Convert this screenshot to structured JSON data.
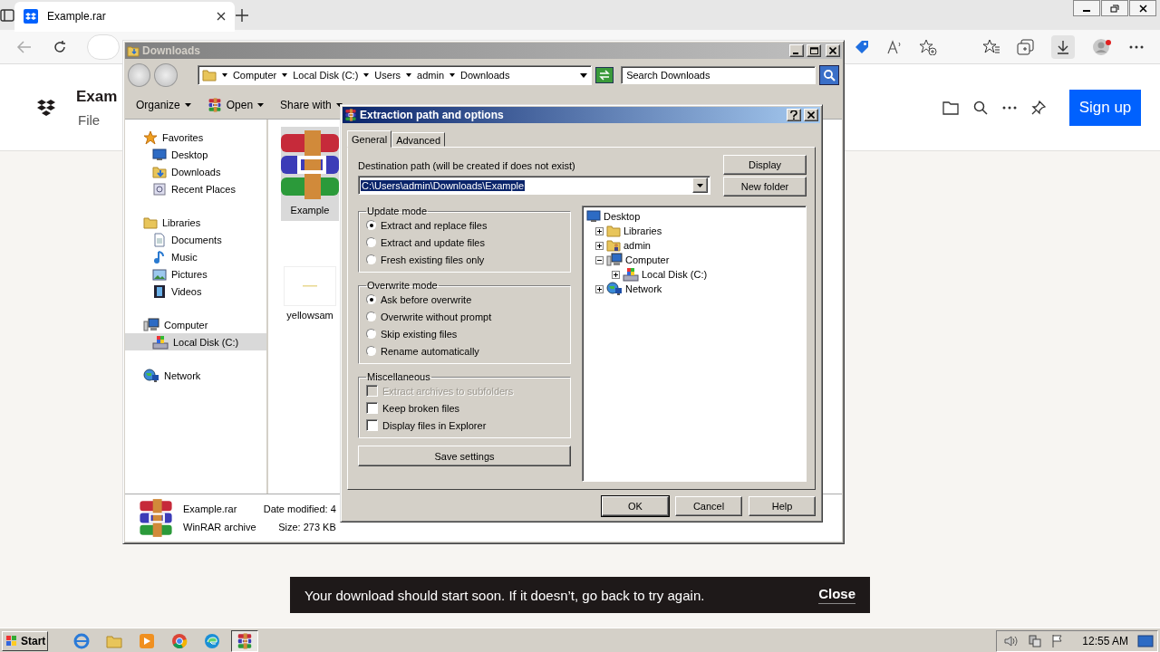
{
  "browser": {
    "tab": {
      "title": "Example.rar"
    },
    "page": {
      "title": "Exam",
      "subtitle": "File",
      "signup": "Sign up"
    },
    "toast": {
      "message": "Your download should start soon. If it doesn’t, go back to try again.",
      "close": "Close"
    }
  },
  "explorer": {
    "title": "Downloads",
    "breadcrumb": [
      "Computer",
      "Local Disk (C:)",
      "Users",
      "admin",
      "Downloads"
    ],
    "search": {
      "placeholder": "Search Downloads"
    },
    "toolbar": [
      "Organize",
      "Open",
      "Share with"
    ],
    "nav": [
      {
        "label": "Favorites",
        "selected": false,
        "children": [
          {
            "label": "Desktop",
            "selected": false
          },
          {
            "label": "Downloads",
            "selected": false
          },
          {
            "label": "Recent Places",
            "selected": false
          }
        ]
      },
      {
        "label": "Libraries",
        "selected": false,
        "children": [
          {
            "label": "Documents",
            "selected": false
          },
          {
            "label": "Music",
            "selected": false
          },
          {
            "label": "Pictures",
            "selected": false
          },
          {
            "label": "Videos",
            "selected": false
          }
        ]
      },
      {
        "label": "Computer",
        "selected": false,
        "children": [
          {
            "label": "Local Disk (C:)",
            "selected": true
          }
        ]
      },
      {
        "label": "Network",
        "selected": false
      }
    ],
    "files": [
      {
        "name": "Example",
        "selected": true
      },
      {
        "name": "yellowsam",
        "selected": false
      }
    ],
    "details": {
      "name": "Example.rar",
      "type": "WinRAR archive",
      "modified": "Date modified: 4",
      "size": "Size: 273 KB"
    }
  },
  "dialog": {
    "title": "Extraction path and options",
    "tabs": [
      {
        "label": "General",
        "selected": true
      },
      {
        "label": "Advanced",
        "selected": false
      }
    ],
    "destination": {
      "label": "Destination path (will be created if does not exist)",
      "value": "C:\\Users\\admin\\Downloads\\Example"
    },
    "side_buttons": [
      "Display",
      "New folder"
    ],
    "update_mode": {
      "title": "Update mode",
      "options": [
        {
          "label": "Extract and replace files",
          "selected": true
        },
        {
          "label": "Extract and update files",
          "selected": false
        },
        {
          "label": "Fresh existing files only",
          "selected": false
        }
      ]
    },
    "overwrite_mode": {
      "title": "Overwrite mode",
      "options": [
        {
          "label": "Ask before overwrite",
          "selected": true
        },
        {
          "label": "Overwrite without prompt",
          "selected": false
        },
        {
          "label": "Skip existing files",
          "selected": false
        },
        {
          "label": "Rename automatically",
          "selected": false
        }
      ]
    },
    "misc": {
      "title": "Miscellaneous",
      "options": [
        {
          "label": "Extract archives to subfolders",
          "checked": false,
          "disabled": true
        },
        {
          "label": "Keep broken files",
          "checked": false,
          "disabled": false
        },
        {
          "label": "Display files in Explorer",
          "checked": false,
          "disabled": false
        }
      ]
    },
    "save": "Save settings",
    "tree": [
      {
        "label": "Desktop",
        "children": [
          {
            "label": "Libraries",
            "expanded": false
          },
          {
            "label": "admin",
            "expanded": false
          },
          {
            "label": "Computer",
            "expanded": true,
            "children": [
              {
                "label": "Local Disk (C:)",
                "expanded": false
              }
            ]
          },
          {
            "label": "Network",
            "expanded": false
          }
        ]
      }
    ],
    "buttons": [
      {
        "label": "OK",
        "default": true
      },
      {
        "label": "Cancel",
        "default": false
      },
      {
        "label": "Help",
        "default": false
      }
    ]
  },
  "taskbar": {
    "start": "Start",
    "apps": [
      {
        "selected": false
      },
      {
        "selected": false
      },
      {
        "selected": false
      },
      {
        "selected": false
      },
      {
        "selected": false
      },
      {
        "selected": true
      }
    ],
    "clock": "12:55 AM"
  }
}
